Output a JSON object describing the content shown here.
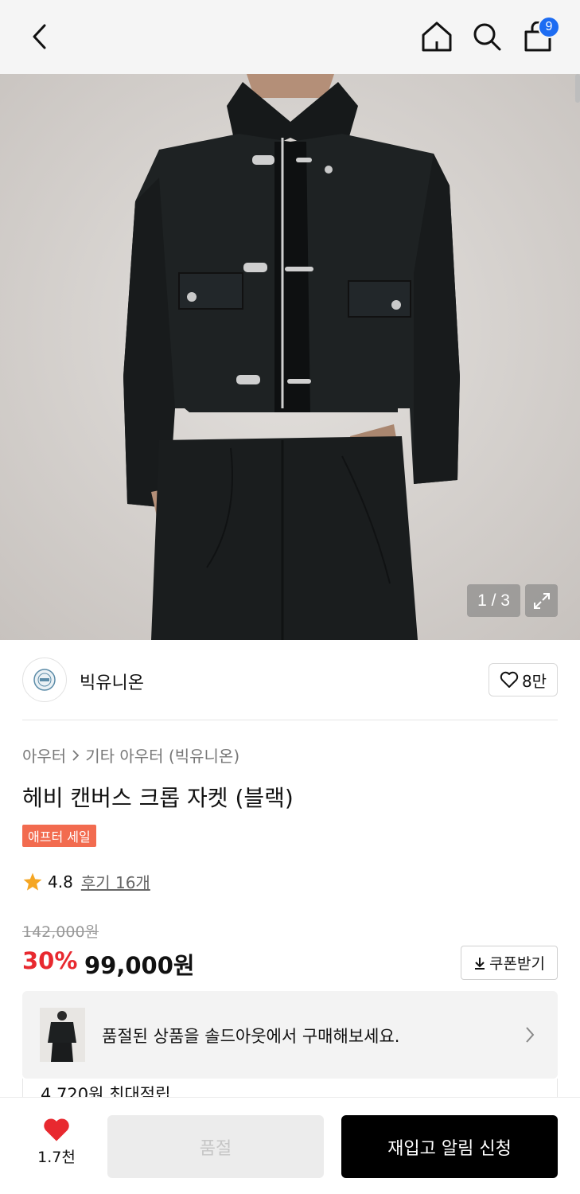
{
  "header": {
    "back_icon": "chevron-left-icon",
    "home_icon": "home-icon",
    "search_icon": "search-icon",
    "cart_icon": "shopping-bag-icon",
    "cart_badge": "9",
    "badge_color": "#1d6cf2"
  },
  "gallery": {
    "counter": "1 / 3",
    "expand_icon": "expand-icon"
  },
  "brand": {
    "name": "빅유니온",
    "like_count": "8만",
    "like_icon": "heart-outline-icon"
  },
  "breadcrumb": {
    "category": "아우터",
    "subcategory": "기타 아우터 (빅유니온)"
  },
  "product": {
    "title": "헤비 캔버스 크롭 자켓 (블랙)",
    "badge": "애프터 세일",
    "badge_color": "#f26b4f",
    "rating": "4.8",
    "reviews": "후기 16개",
    "original_price": "142,000원",
    "discount": "30%",
    "discount_color": "#e8292f",
    "price": "99,000원",
    "coupon_label": "쿠폰받기"
  },
  "soldout_banner": {
    "text": "품절된 상품을 솔드아웃에서 구매해보세요."
  },
  "points": {
    "text": "4,720원 최대적립"
  },
  "bottom_bar": {
    "wish_count": "1.7천",
    "wish_color": "#e8292f",
    "soldout_label": "품절",
    "restock_label": "재입고 알림 신청"
  }
}
